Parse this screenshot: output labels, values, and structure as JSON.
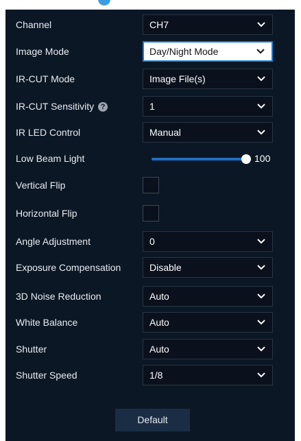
{
  "settings": {
    "channel": {
      "label": "Channel",
      "value": "CH7"
    },
    "image_mode": {
      "label": "Image Mode",
      "value": "Day/Night Mode"
    },
    "ircut_mode": {
      "label": "IR-CUT Mode",
      "value": "Image File(s)"
    },
    "ircut_sensitivity": {
      "label": "IR-CUT Sensitivity",
      "help": "?",
      "value": "1"
    },
    "ir_led_control": {
      "label": "IR LED Control",
      "value": "Manual"
    },
    "low_beam_light": {
      "label": "Low Beam Light",
      "value": "100",
      "level": 1.0
    },
    "vertical_flip": {
      "label": "Vertical Flip",
      "checked": false
    },
    "horizontal_flip": {
      "label": "Horizontal Flip",
      "checked": false
    },
    "angle_adjustment": {
      "label": "Angle Adjustment",
      "value": "0"
    },
    "exposure_compensation": {
      "label": "Exposure Compensation",
      "value": "Disable"
    },
    "noise_reduction": {
      "label": "3D Noise Reduction",
      "value": "Auto"
    },
    "white_balance": {
      "label": "White Balance",
      "value": "Auto"
    },
    "shutter": {
      "label": "Shutter",
      "value": "Auto"
    },
    "shutter_speed": {
      "label": "Shutter Speed",
      "value": "1/8"
    }
  },
  "footer": {
    "default_label": "Default"
  },
  "colors": {
    "panel_bg": "#0c1725",
    "accent": "#1e7fd4",
    "text": "#e8ecf2"
  }
}
